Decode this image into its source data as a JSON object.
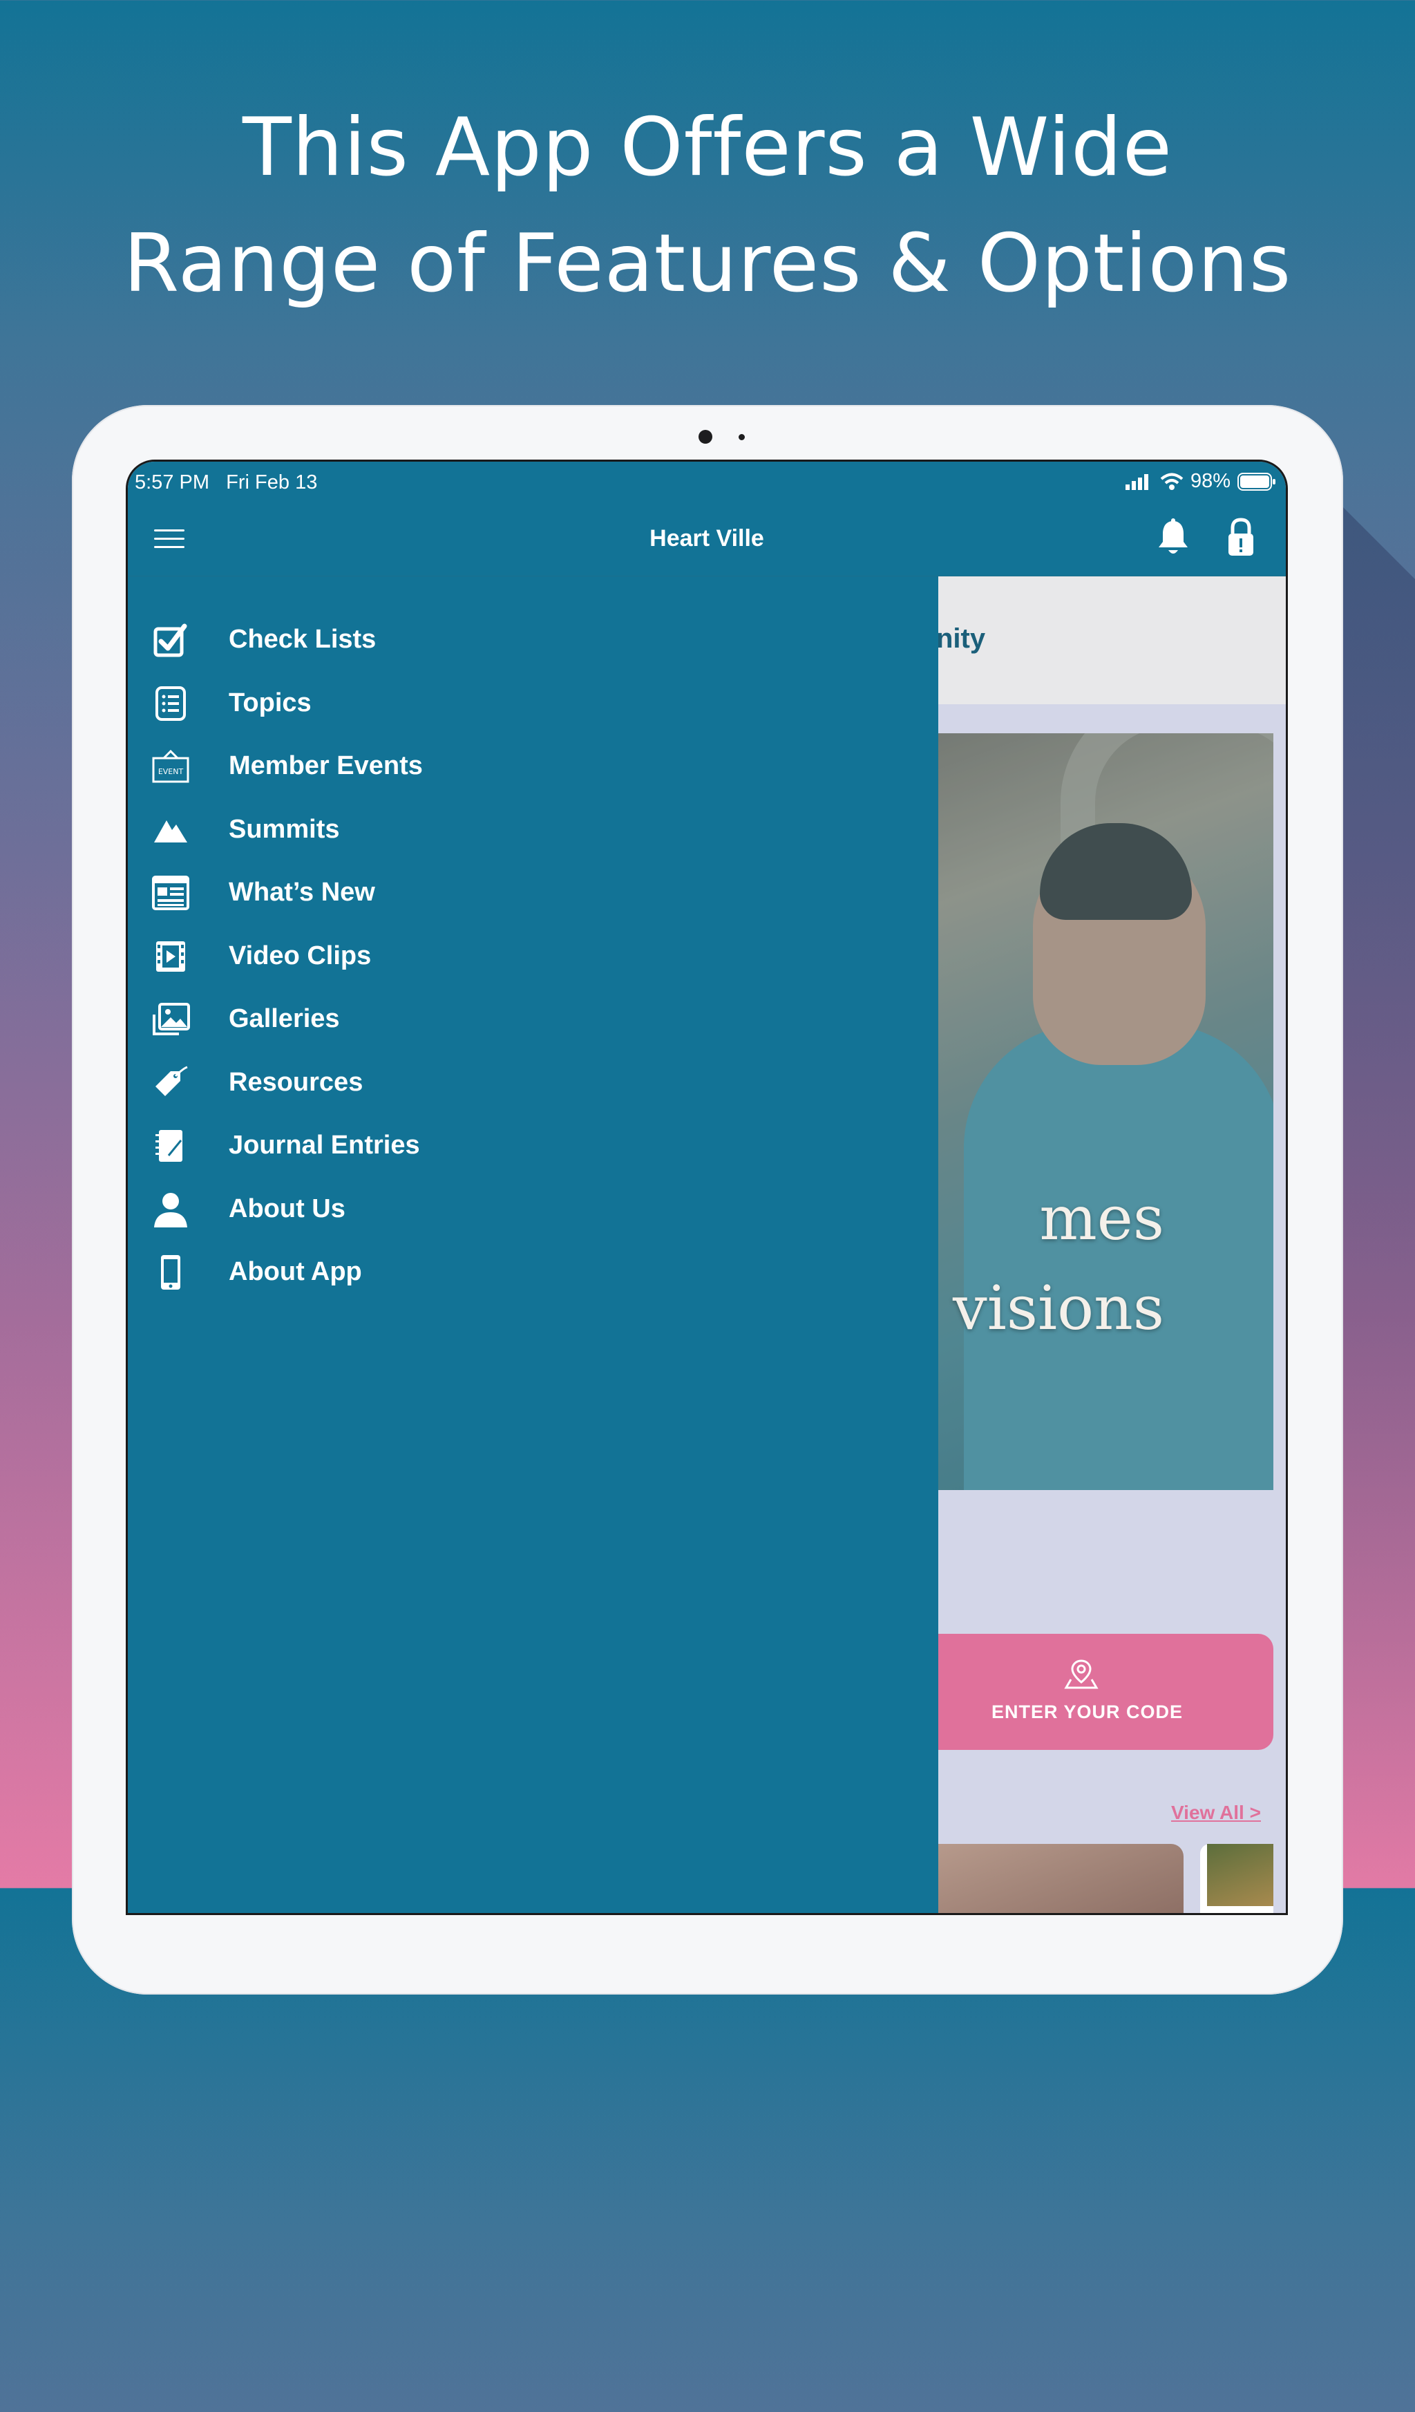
{
  "marketing": {
    "headline_line1": "This App Offers a Wide",
    "headline_line2": "Range of Features & Options"
  },
  "status_bar": {
    "time": "5:57 PM",
    "date": "Fri Feb 13",
    "battery": "98%",
    "icons": [
      "signal-icon",
      "wifi-icon",
      "battery-icon"
    ]
  },
  "app_bar": {
    "title": "Heart Ville",
    "icons": [
      "menu-icon",
      "bell-icon",
      "lock-icon"
    ]
  },
  "drawer": {
    "items": [
      {
        "label": "Check Lists",
        "icon": "checkbox-icon"
      },
      {
        "label": "Topics",
        "icon": "list-icon"
      },
      {
        "label": "Member Events",
        "icon": "event-sign-icon"
      },
      {
        "label": "Summits",
        "icon": "mountain-icon"
      },
      {
        "label": "What’s New",
        "icon": "newspaper-icon"
      },
      {
        "label": "Video Clips",
        "icon": "film-icon"
      },
      {
        "label": "Galleries",
        "icon": "images-icon"
      },
      {
        "label": "Resources",
        "icon": "tag-icon"
      },
      {
        "label": "Journal Entries",
        "icon": "notebook-icon"
      },
      {
        "label": "About Us",
        "icon": "person-icon"
      },
      {
        "label": "About App",
        "icon": "phone-icon"
      }
    ]
  },
  "background_content": {
    "header_partial": "nity",
    "hero_line1": "mes",
    "hero_line2": "visions",
    "code_button_label": "ENTER YOUR CODE",
    "view_all_label": "View All >"
  },
  "colors": {
    "primary": "#127396",
    "accent_pink": "#e0719b",
    "content_bg": "#d3d6e8"
  }
}
